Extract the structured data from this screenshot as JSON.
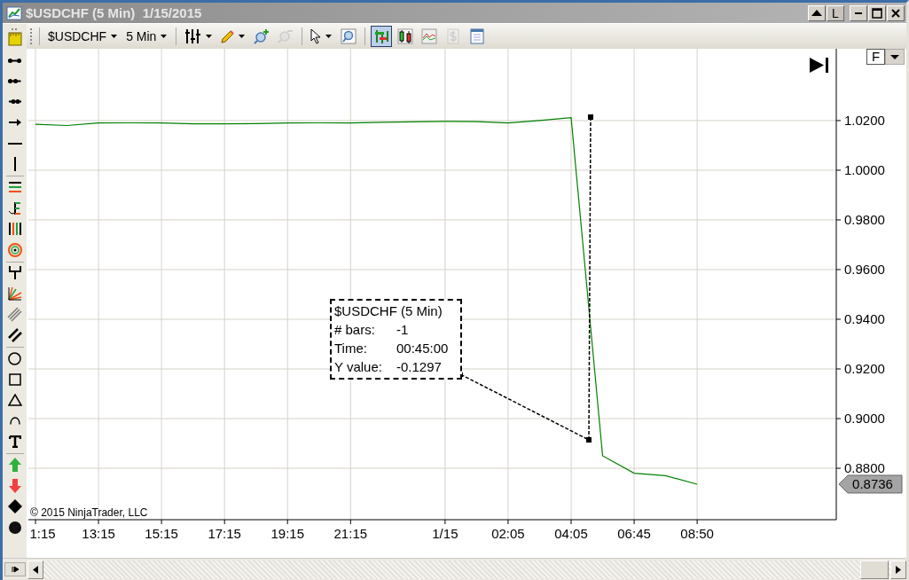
{
  "window": {
    "title": "$USDCHF (5 Min)  1/15/2015",
    "layout_button": "L"
  },
  "toolbar": {
    "instrument": "$USDCHF",
    "interval": "5 Min",
    "style_buttons": [
      {
        "kind": "bars",
        "selected": true,
        "disabled": false
      },
      {
        "kind": "candles",
        "selected": false,
        "disabled": false
      },
      {
        "kind": "line",
        "selected": false,
        "disabled": false
      },
      {
        "kind": "dollar",
        "selected": false,
        "disabled": true
      },
      {
        "kind": "panel",
        "selected": false,
        "disabled": false
      }
    ]
  },
  "chart": {
    "copyright": "© 2015 NinjaTrader, LLC",
    "scale_button": "F",
    "last_price": "0.8736",
    "chart_data": {
      "type": "line",
      "grid": true,
      "categories": [
        "1:15",
        null,
        "13:15",
        null,
        "15:15",
        null,
        "17:15",
        null,
        "19:15",
        null,
        "21:15",
        null,
        null,
        "1/15",
        null,
        "02:05",
        null,
        "04:05",
        null,
        "06:45",
        null,
        "08:50"
      ],
      "ylim": [
        0.8593,
        1.0489
      ],
      "yticks": [
        {
          "value": 1.02,
          "label": "1.0200"
        },
        {
          "value": 1.0,
          "label": "1.0000"
        },
        {
          "value": 0.98,
          "label": "0.9800"
        },
        {
          "value": 0.96,
          "label": "0.9600"
        },
        {
          "value": 0.94,
          "label": "0.9400"
        },
        {
          "value": 0.92,
          "label": "0.9200"
        },
        {
          "value": 0.9,
          "label": "0.9000"
        },
        {
          "value": 0.88,
          "label": "0.8800"
        }
      ],
      "series": [
        {
          "color": "#008000",
          "values": [
            1.0185,
            1.018,
            1.019,
            1.0191,
            1.019,
            1.0187,
            1.0187,
            1.0188,
            1.019,
            1.0191,
            1.019,
            1.0193,
            1.0195,
            1.0197,
            1.0196,
            1.019,
            1.02,
            1.0212,
            0.885,
            0.878,
            0.877,
            0.8736
          ]
        }
      ]
    },
    "data_box": {
      "title": "$USDCHF (5 Min)",
      "rows": [
        {
          "label": "# bars:",
          "value": "-1"
        },
        {
          "label": "Time:",
          "value": "00:45:00"
        },
        {
          "label": "Y value:",
          "value": "-0.1297"
        }
      ]
    }
  }
}
